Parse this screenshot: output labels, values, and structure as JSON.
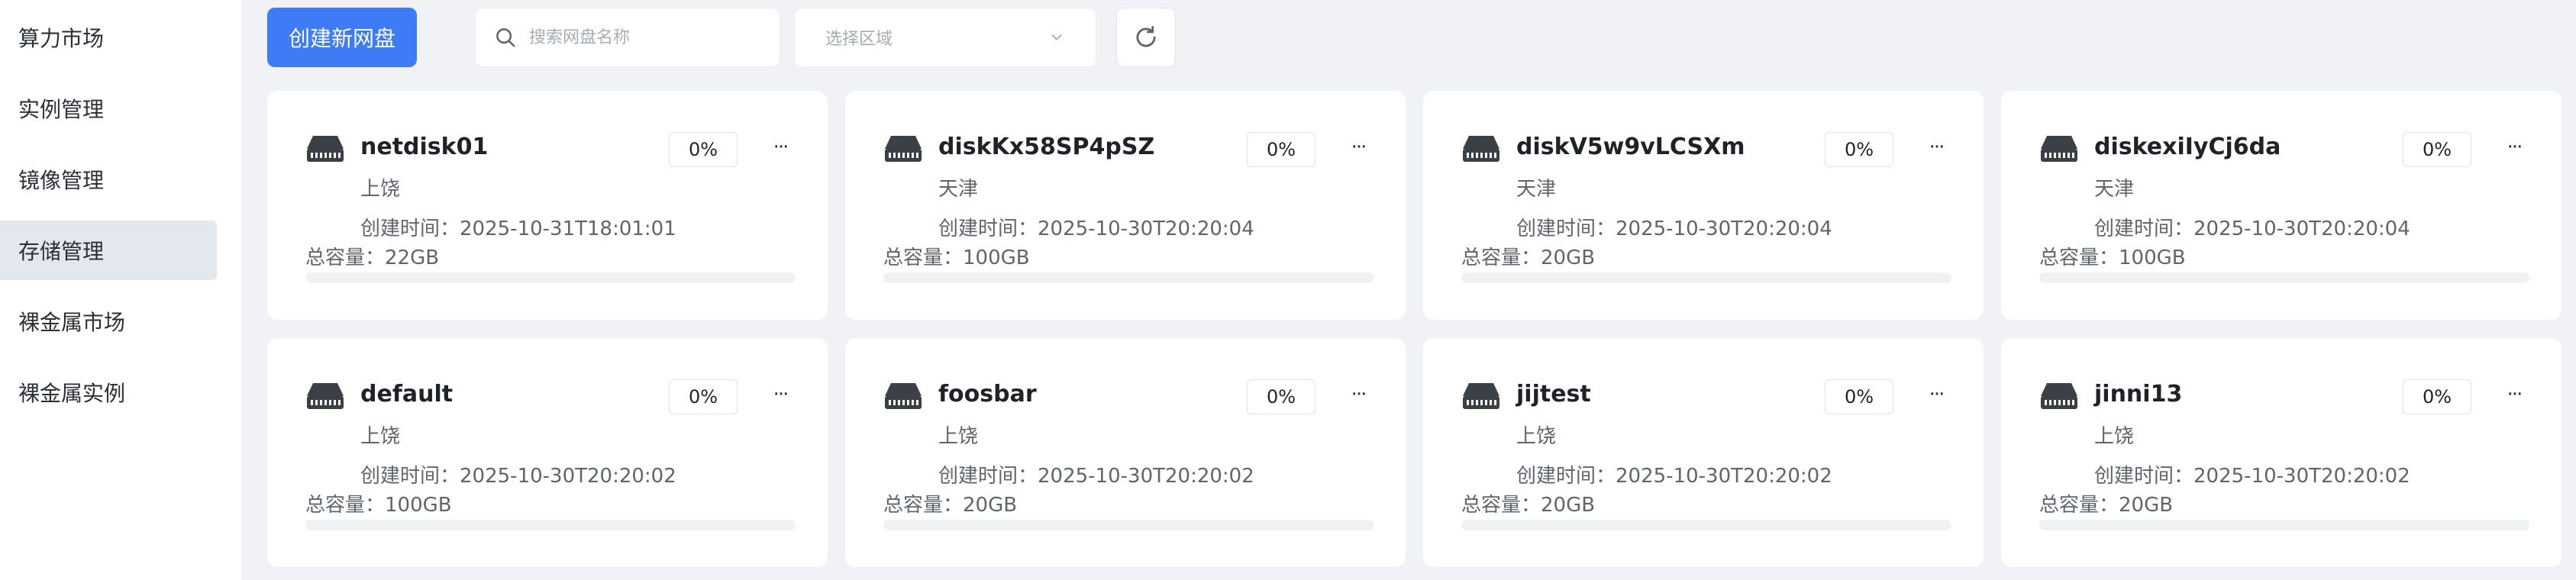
{
  "sidebar": {
    "items": [
      {
        "label": "算力市场",
        "active": false
      },
      {
        "label": "实例管理",
        "active": false
      },
      {
        "label": "镜像管理",
        "active": false
      },
      {
        "label": "存储管理",
        "active": true
      },
      {
        "label": "裸金属市场",
        "active": false
      },
      {
        "label": "裸金属实例",
        "active": false
      }
    ]
  },
  "toolbar": {
    "create_label": "创建新网盘",
    "search_placeholder": "搜索网盘名称",
    "search_value": "",
    "region_placeholder": "选择区域",
    "search_icon": "search-icon",
    "refresh_icon": "refresh-icon",
    "chevron_icon": "chevron-down-icon"
  },
  "colors": {
    "accent": "#3d7bf7",
    "background": "#f1f2f5",
    "sidebar_active": "#e3e7ee"
  },
  "disks": [
    {
      "name": "netdisk01",
      "region": "上饶",
      "created_label": "创建时间：",
      "created": "2025-10-31T18:01:01",
      "capacity_label": "总容量：",
      "capacity": "22GB",
      "usage": "0%",
      "usage_fraction": 0
    },
    {
      "name": "diskKx58SP4pSZ",
      "region": "天津",
      "created_label": "创建时间：",
      "created": "2025-10-30T20:20:04",
      "capacity_label": "总容量：",
      "capacity": "100GB",
      "usage": "0%",
      "usage_fraction": 0
    },
    {
      "name": "diskV5w9vLCSXm",
      "region": "天津",
      "created_label": "创建时间：",
      "created": "2025-10-30T20:20:04",
      "capacity_label": "总容量：",
      "capacity": "20GB",
      "usage": "0%",
      "usage_fraction": 0
    },
    {
      "name": "diskexiIyCj6da",
      "region": "天津",
      "created_label": "创建时间：",
      "created": "2025-10-30T20:20:04",
      "capacity_label": "总容量：",
      "capacity": "100GB",
      "usage": "0%",
      "usage_fraction": 0
    },
    {
      "name": "default",
      "region": "上饶",
      "created_label": "创建时间：",
      "created": "2025-10-30T20:20:02",
      "capacity_label": "总容量：",
      "capacity": "100GB",
      "usage": "0%",
      "usage_fraction": 0
    },
    {
      "name": "foosbar",
      "region": "上饶",
      "created_label": "创建时间：",
      "created": "2025-10-30T20:20:02",
      "capacity_label": "总容量：",
      "capacity": "20GB",
      "usage": "0%",
      "usage_fraction": 0
    },
    {
      "name": "jijtest",
      "region": "上饶",
      "created_label": "创建时间：",
      "created": "2025-10-30T20:20:02",
      "capacity_label": "总容量：",
      "capacity": "20GB",
      "usage": "0%",
      "usage_fraction": 0
    },
    {
      "name": "jinni13",
      "region": "上饶",
      "created_label": "创建时间：",
      "created": "2025-10-30T20:20:02",
      "capacity_label": "总容量：",
      "capacity": "20GB",
      "usage": "0%",
      "usage_fraction": 0
    }
  ],
  "card_more_label": "···"
}
